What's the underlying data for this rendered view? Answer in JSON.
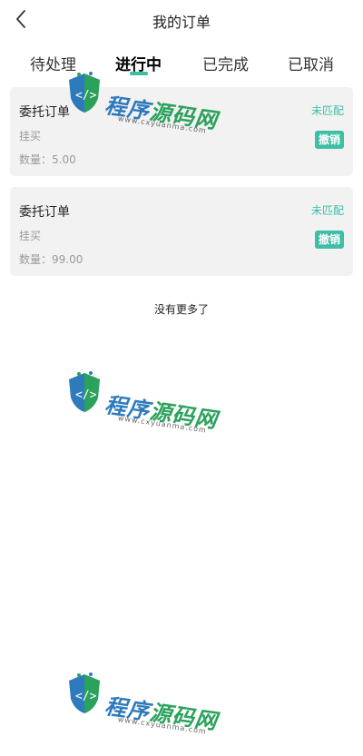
{
  "header": {
    "title": "我的订单",
    "back_icon": "chevron-left-icon"
  },
  "tabs": [
    {
      "label": "待处理",
      "active": false
    },
    {
      "label": "进行中",
      "active": true
    },
    {
      "label": "已完成",
      "active": false
    },
    {
      "label": "已取消",
      "active": false
    }
  ],
  "orders": [
    {
      "title": "委托订单",
      "type": "挂买",
      "quantity": "数量：5.00",
      "status": "未匹配",
      "cancel_label": "撤销"
    },
    {
      "title": "委托订单",
      "type": "挂买",
      "quantity": "数量：99.00",
      "status": "未匹配",
      "cancel_label": "撤销"
    }
  ],
  "footer": {
    "no_more": "没有更多了"
  },
  "watermark": {
    "brand_a": "程序",
    "brand_b": "源码网",
    "url": "www.cxyuanma.com"
  },
  "colors": {
    "accent": "#3dbfa6",
    "card_bg": "#f2f2f2",
    "muted_text": "#9a9a9a"
  }
}
